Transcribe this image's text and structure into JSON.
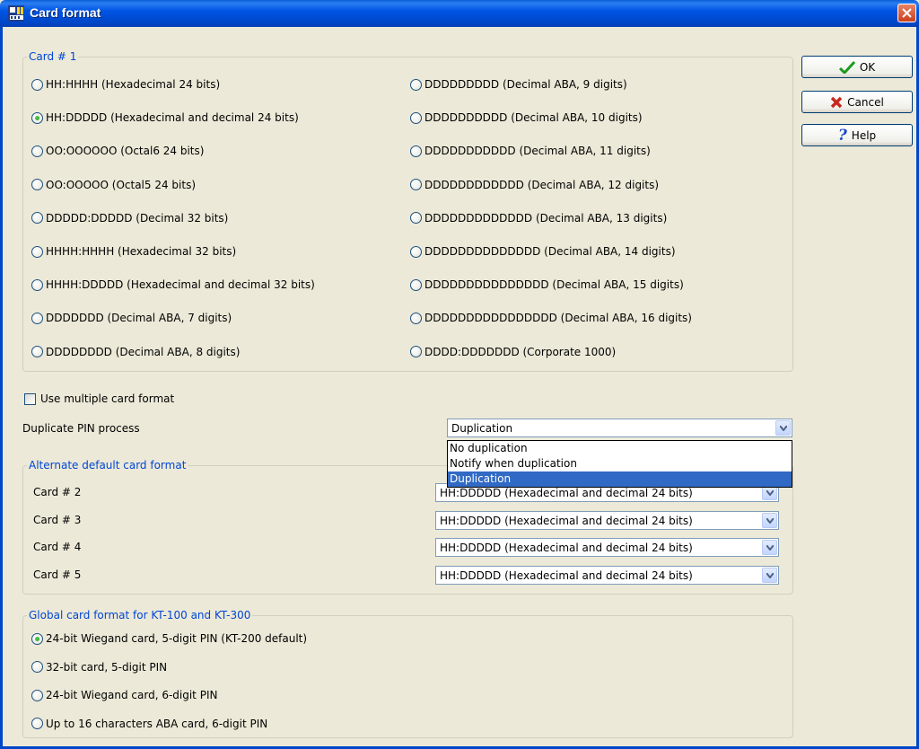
{
  "window": {
    "title": "Card format",
    "icon": "app-card-icon"
  },
  "buttons": {
    "ok": "OK",
    "cancel": "Cancel",
    "help": "Help"
  },
  "card1": {
    "legend": "Card # 1",
    "left": [
      {
        "label": "HH:HHHH (Hexadecimal 24 bits)",
        "selected": false
      },
      {
        "label": "HH:DDDDD (Hexadecimal and decimal 24 bits)",
        "selected": true
      },
      {
        "label": "OO:OOOOOO (Octal6 24 bits)",
        "selected": false
      },
      {
        "label": "OO:OOOOO (Octal5 24 bits)",
        "selected": false
      },
      {
        "label": "DDDDD:DDDDD (Decimal 32 bits)",
        "selected": false
      },
      {
        "label": "HHHH:HHHH (Hexadecimal 32 bits)",
        "selected": false
      },
      {
        "label": "HHHH:DDDDD (Hexadecimal and decimal 32 bits)",
        "selected": false
      },
      {
        "label": "DDDDDDD (Decimal ABA, 7 digits)",
        "selected": false
      },
      {
        "label": "DDDDDDDD (Decimal ABA, 8 digits)",
        "selected": false
      }
    ],
    "right": [
      {
        "label": "DDDDDDDDD (Decimal ABA, 9 digits)",
        "selected": false
      },
      {
        "label": "DDDDDDDDDD (Decimal ABA, 10 digits)",
        "selected": false
      },
      {
        "label": "DDDDDDDDDDD (Decimal ABA, 11 digits)",
        "selected": false
      },
      {
        "label": "DDDDDDDDDDDD (Decimal ABA, 12 digits)",
        "selected": false
      },
      {
        "label": "DDDDDDDDDDDDD (Decimal ABA, 13 digits)",
        "selected": false
      },
      {
        "label": "DDDDDDDDDDDDDD (Decimal ABA, 14 digits)",
        "selected": false
      },
      {
        "label": "DDDDDDDDDDDDDDD (Decimal ABA, 15 digits)",
        "selected": false
      },
      {
        "label": "DDDDDDDDDDDDDDDD (Decimal ABA, 16 digits)",
        "selected": false
      },
      {
        "label": "DDDD:DDDDDDD (Corporate 1000)",
        "selected": false
      }
    ]
  },
  "multiple": {
    "label": "Use multiple card format",
    "checked": false
  },
  "duplicate": {
    "label": "Duplicate PIN process",
    "value": "Duplication",
    "options": [
      "No duplication",
      "Notify when duplication",
      "Duplication"
    ],
    "selected_index": 2
  },
  "alternate": {
    "legend": "Alternate default card format",
    "rows": [
      {
        "label": "Card # 2",
        "value": "HH:DDDDD (Hexadecimal and decimal 24 bits)"
      },
      {
        "label": "Card # 3",
        "value": "HH:DDDDD (Hexadecimal and decimal 24 bits)"
      },
      {
        "label": "Card # 4",
        "value": "HH:DDDDD (Hexadecimal and decimal 24 bits)"
      },
      {
        "label": "Card # 5",
        "value": "HH:DDDDD (Hexadecimal and decimal 24 bits)"
      }
    ]
  },
  "global": {
    "legend": "Global card format for KT-100 and KT-300",
    "options": [
      {
        "label": "24-bit Wiegand card, 5-digit PIN (KT-200 default)",
        "selected": true
      },
      {
        "label": "32-bit card, 5-digit PIN",
        "selected": false
      },
      {
        "label": "24-bit Wiegand card, 6-digit PIN",
        "selected": false
      },
      {
        "label": "Up to 16 characters ABA card, 6-digit PIN",
        "selected": false
      }
    ]
  },
  "colors": {
    "titlebar": "#0055e5",
    "face": "#ece9d8",
    "legend": "#0046d5",
    "selection": "#316ac5"
  }
}
